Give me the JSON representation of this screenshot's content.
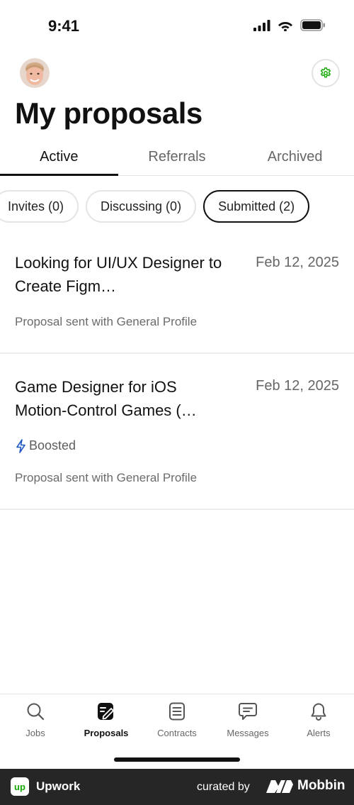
{
  "status_bar": {
    "time": "9:41"
  },
  "header": {
    "title": "My proposals"
  },
  "tabs": [
    {
      "label": "Active",
      "active": true
    },
    {
      "label": "Referrals",
      "active": false
    },
    {
      "label": "Archived",
      "active": false
    }
  ],
  "chips": [
    {
      "label": "Invites (0)",
      "selected": false
    },
    {
      "label": "Discussing (0)",
      "selected": false
    },
    {
      "label": "Submitted (2)",
      "selected": true
    }
  ],
  "proposals": [
    {
      "title": "Looking for UI/UX Designer to Create Figm…",
      "date": "Feb 12, 2025",
      "subtitle": "Proposal sent with General Profile"
    },
    {
      "title": "Game Designer for iOS Motion-Control Games (…",
      "date": "Feb 12, 2025",
      "badge": "Boosted",
      "subtitle": "Proposal sent with General Profile"
    }
  ],
  "bottom_nav": [
    {
      "label": "Jobs",
      "icon": "search-icon",
      "active": false
    },
    {
      "label": "Proposals",
      "icon": "proposals-icon",
      "active": true
    },
    {
      "label": "Contracts",
      "icon": "contracts-icon",
      "active": false
    },
    {
      "label": "Messages",
      "icon": "messages-icon",
      "active": false
    },
    {
      "label": "Alerts",
      "icon": "bell-icon",
      "active": false
    }
  ],
  "footer": {
    "app_name": "Upwork",
    "logo_text": "up",
    "curated_by": "curated by",
    "brand": "Mobbin"
  },
  "colors": {
    "accent_green": "#14a800",
    "boost_blue": "#1f57c3",
    "footer_bg": "#262626"
  }
}
